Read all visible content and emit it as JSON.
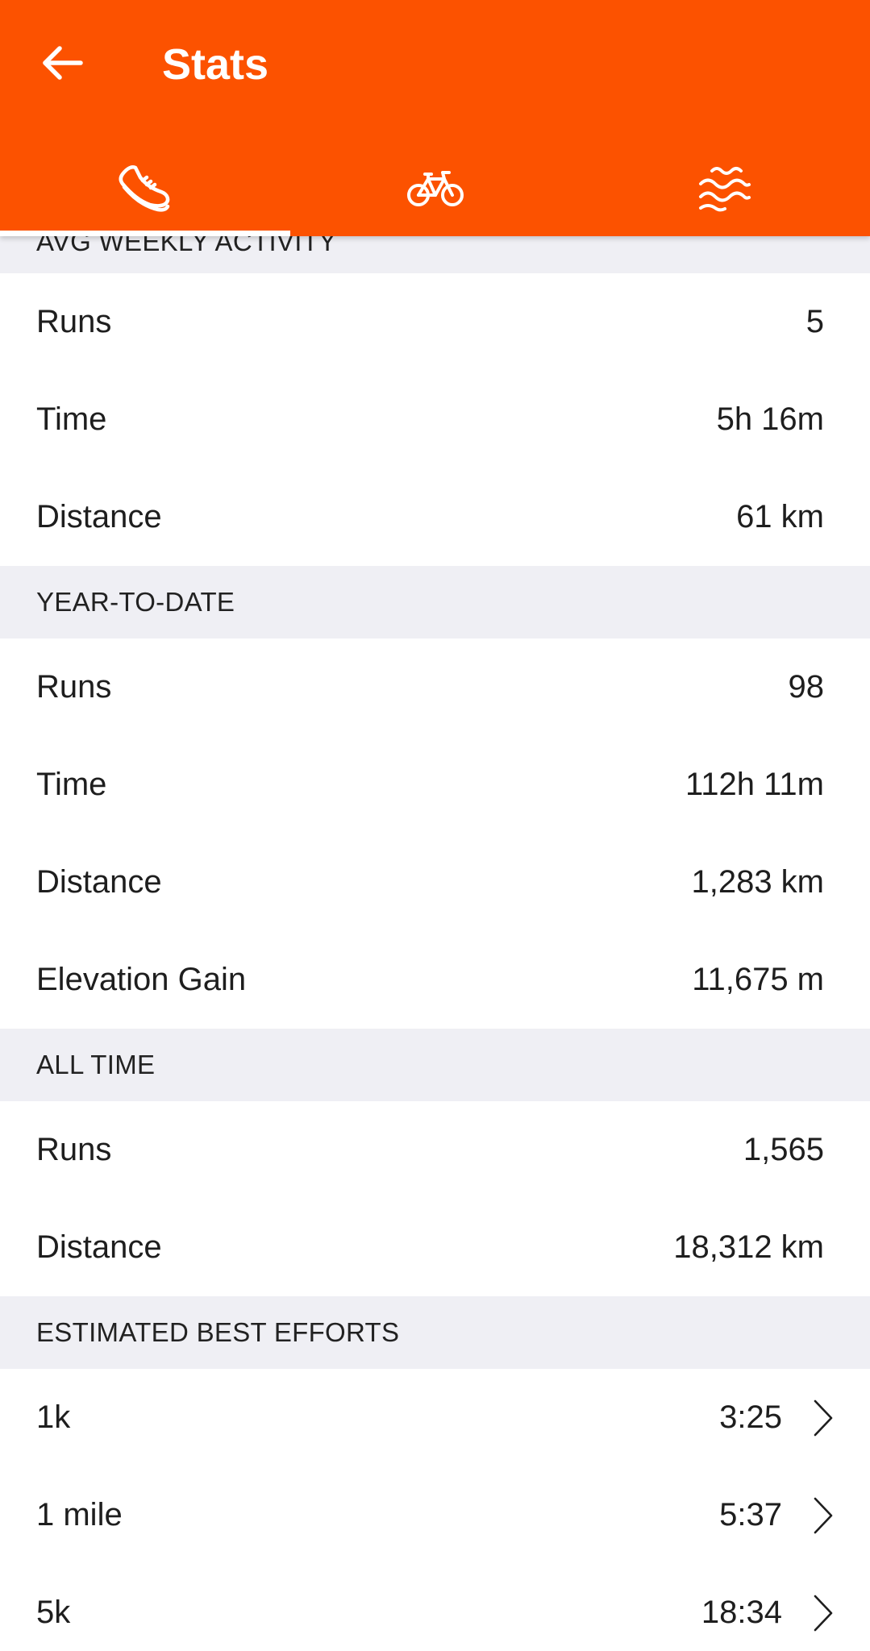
{
  "header": {
    "title": "Stats",
    "back_icon": "arrow-left-icon",
    "background": "#fc5200"
  },
  "tabs": [
    {
      "icon": "running-shoe-icon",
      "selected": true
    },
    {
      "icon": "bicycle-icon",
      "selected": false
    },
    {
      "icon": "waves-icon",
      "selected": false
    }
  ],
  "sections": {
    "avg_weekly": {
      "title": "AVG WEEKLY ACTIVITY",
      "rows": [
        {
          "label": "Runs",
          "value": "5"
        },
        {
          "label": "Time",
          "value": "5h 16m"
        },
        {
          "label": "Distance",
          "value": "61 km"
        }
      ]
    },
    "ytd": {
      "title": "YEAR-TO-DATE",
      "rows": [
        {
          "label": "Runs",
          "value": "98"
        },
        {
          "label": "Time",
          "value": "112h 11m"
        },
        {
          "label": "Distance",
          "value": "1,283 km"
        },
        {
          "label": "Elevation Gain",
          "value": "11,675 m"
        }
      ]
    },
    "all_time": {
      "title": "ALL TIME",
      "rows": [
        {
          "label": "Runs",
          "value": "1,565"
        },
        {
          "label": "Distance",
          "value": "18,312 km"
        }
      ]
    },
    "best_efforts": {
      "title": "ESTIMATED BEST EFFORTS",
      "rows": [
        {
          "label": "1k",
          "value": "3:25"
        },
        {
          "label": "1 mile",
          "value": "5:37"
        },
        {
          "label": "5k",
          "value": "18:34"
        }
      ]
    }
  }
}
